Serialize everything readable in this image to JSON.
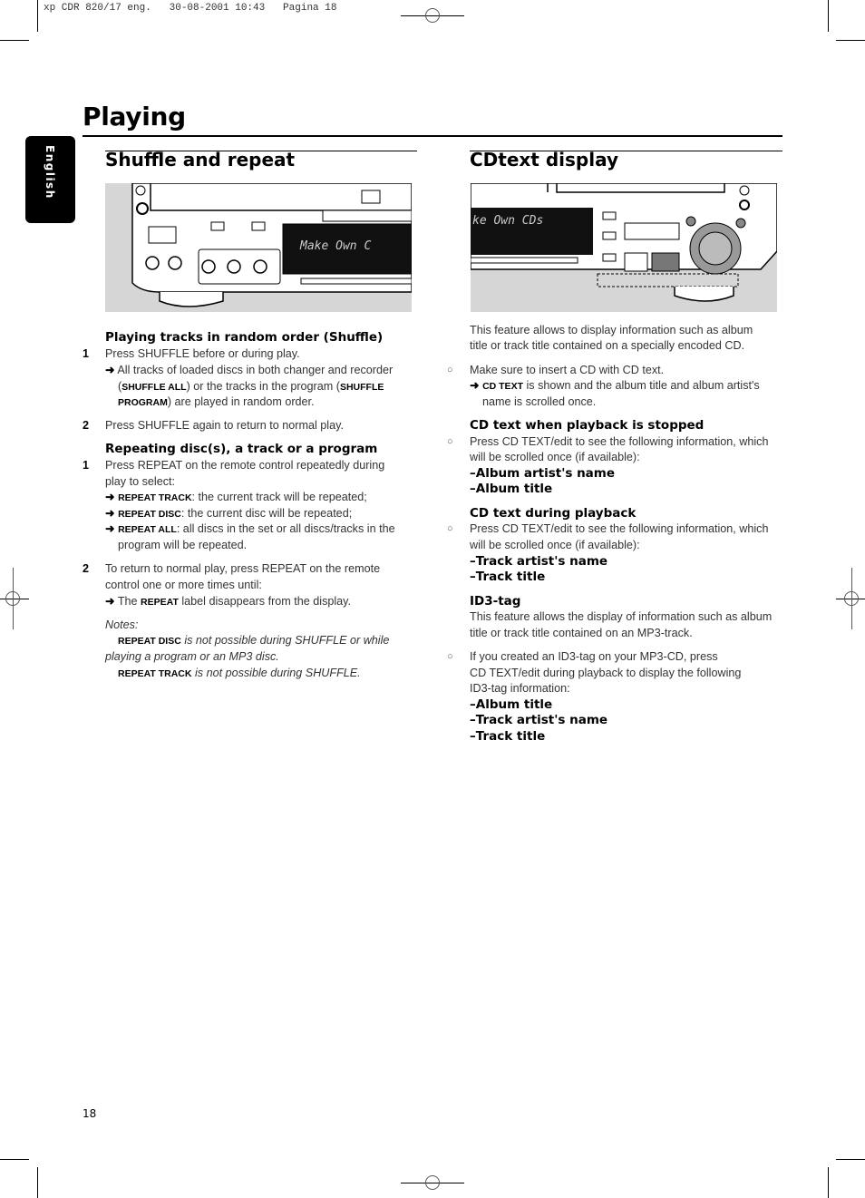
{
  "print_header": "xp CDR 820/17 eng.   30-08-2001 10:43   Pagina 18",
  "language_tab": "English",
  "page_title": "Playing",
  "page_number": "18",
  "icons": {
    "arrow": "➜",
    "bullet": "○",
    "dash": "–"
  },
  "left": {
    "heading": "Shuffle and repeat",
    "shuffle": {
      "heading": "Playing tracks in random order (Shuffle)",
      "step1_num": "1",
      "step1": "Press SHUFFLE before or during play.",
      "r1a": "All tracks of loaded discs in both changer and recorder",
      "r1b_pre": "(",
      "r1b_b1": "SHUFFLE ALL",
      "r1b_mid": ") or the tracks in the program (",
      "r1b_b2": "SHUFFLE",
      "r1c_b": "PROGRAM",
      "r1c": ") are played in random order.",
      "step2_num": "2",
      "step2": "Press SHUFFLE again to return to normal play."
    },
    "repeat": {
      "heading": "Repeating disc(s), a track or a program",
      "step1_num": "1",
      "step1a": "Press REPEAT on the remote control repeatedly during",
      "step1b": "play to select:",
      "opt1_b": "REPEAT TRACK",
      "opt1": ": the current track will be repeated;",
      "opt2_b": "REPEAT DISC",
      "opt2": ": the current disc will be repeated;",
      "opt3_b": "REPEAT ALL",
      "opt3a": ": all discs in the set or all discs/tracks in the",
      "opt3b": "program will be repeated.",
      "step2_num": "2",
      "step2a": "To return to normal play, press REPEAT on the remote",
      "step2b": "control one or more times until:",
      "r2_pre": "The ",
      "r2_b": "REPEAT",
      "r2": " label disappears from the display."
    },
    "notes": {
      "label": "Notes:",
      "n1_b": "REPEAT DISC",
      "n1a": " is not possible during SHUFFLE or while",
      "n1b": "playing a program or an MP3 disc.",
      "n2_b": "REPEAT TRACK",
      "n2": " is not possible during SHUFFLE."
    },
    "illustration_display": "Make Own C"
  },
  "right": {
    "heading": "CDtext display",
    "intro_a": "This feature allows to display information such as album",
    "intro_b": "title or track title contained on a specially encoded CD.",
    "b1": "Make sure to insert a CD with CD text.",
    "r1_b": "CD TEXT",
    "r1a": " is shown and the album title and album artist's",
    "r1b": "name is scrolled once.",
    "stopped": {
      "heading": "CD text when playback is stopped",
      "a": "Press CD TEXT/edit to see the following information, which",
      "b": "will be scrolled once (if available):",
      "i1": "Album artist's name",
      "i2": "Album title"
    },
    "during": {
      "heading": "CD text during playback",
      "a": "Press CD TEXT/edit to see the following information, which",
      "b": "will be scrolled once (if available):",
      "i1": "Track artist's name",
      "i2": "Track title"
    },
    "id3": {
      "heading": "ID3-tag",
      "a": "This feature allows the display of information such as album",
      "b": "title or track title contained on an MP3-track.",
      "s_a": "If you created an ID3-tag on your MP3-CD, press",
      "s_b": "CD TEXT/edit during playback to display the following",
      "s_c": "ID3-tag information:",
      "i1": "Album title",
      "i2": "Track artist's name",
      "i3": "Track title"
    },
    "illustration_display": "ke Own CDs"
  }
}
